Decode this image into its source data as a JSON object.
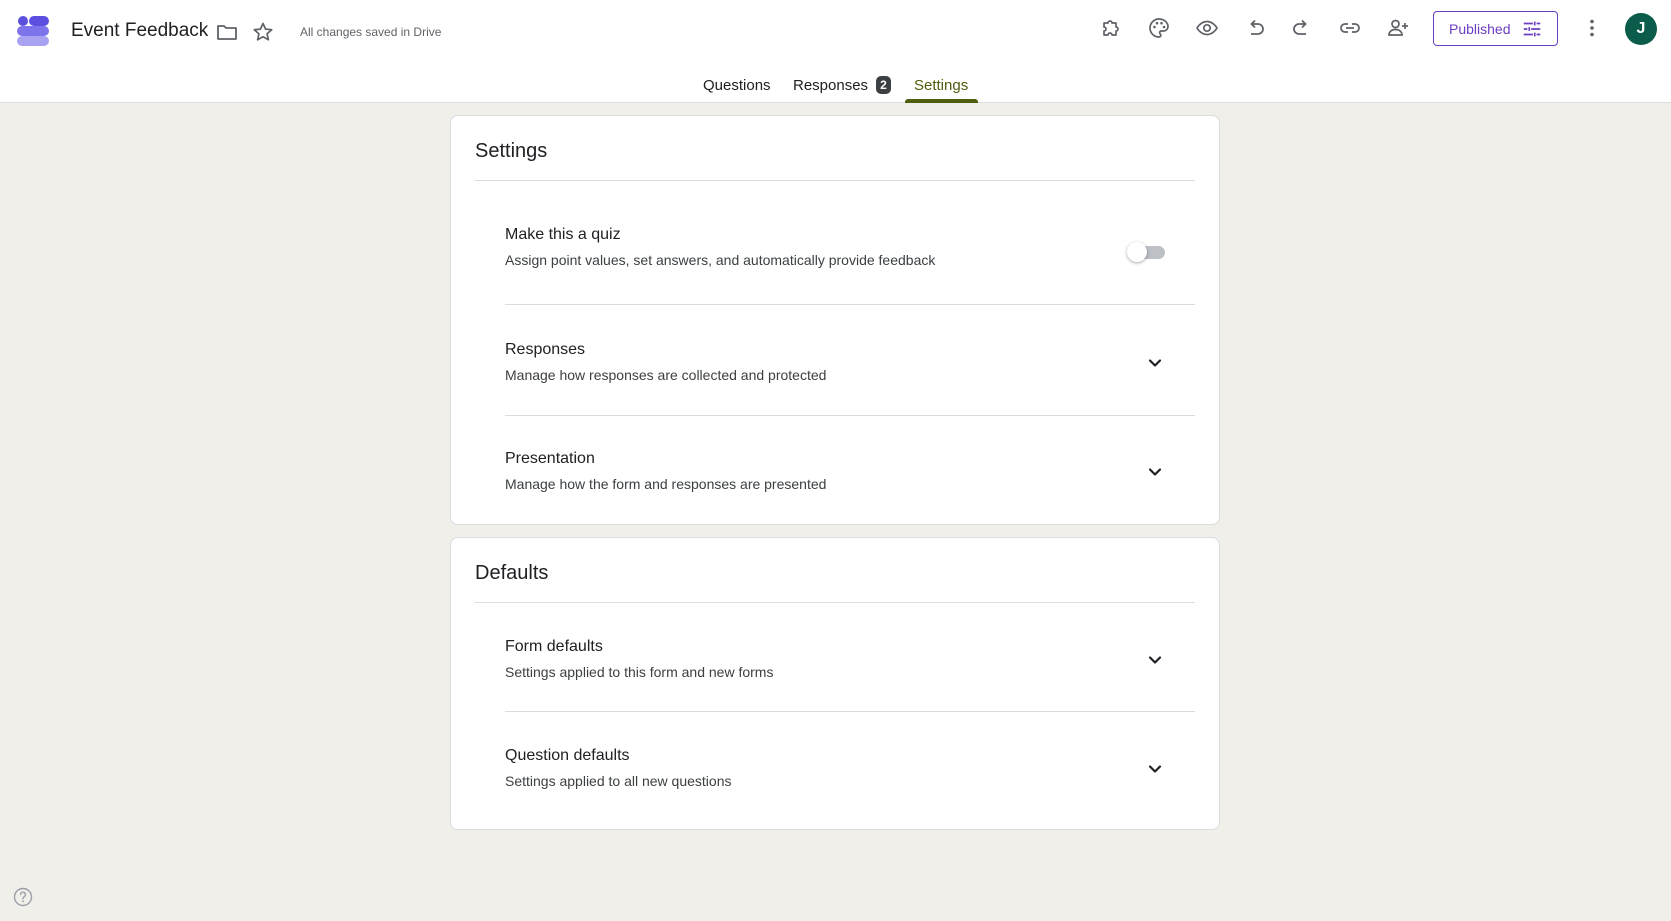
{
  "header": {
    "doc_title": "Event Feedback",
    "save_status": "All changes saved in Drive",
    "publish_label": "Published",
    "avatar_letter": "J"
  },
  "tabs": [
    {
      "label": "Questions"
    },
    {
      "label": "Responses",
      "badge": "2"
    },
    {
      "label": "Settings",
      "active": true
    }
  ],
  "settings_card": {
    "title": "Settings",
    "rows": [
      {
        "title": "Make this a quiz",
        "desc": "Assign point values, set answers, and automatically provide feedback",
        "control": "toggle",
        "on": false
      },
      {
        "title": "Responses",
        "desc": "Manage how responses are collected and protected",
        "control": "expand"
      },
      {
        "title": "Presentation",
        "desc": "Manage how the form and responses are presented",
        "control": "expand"
      }
    ]
  },
  "defaults_card": {
    "title": "Defaults",
    "rows": [
      {
        "title": "Form defaults",
        "desc": "Settings applied to this form and new forms",
        "control": "expand"
      },
      {
        "title": "Question defaults",
        "desc": "Settings applied to all new questions",
        "control": "expand"
      }
    ]
  },
  "icons": {
    "logo": "forms-logo-icon",
    "folder": "folder-icon",
    "star": "star-icon",
    "addons": "puzzle-icon",
    "theme": "palette-icon",
    "preview": "eye-icon",
    "undo": "undo-icon",
    "redo": "redo-icon",
    "link": "link-icon",
    "collaborators": "person-add-icon",
    "publish_options": "tune-icon",
    "more": "more-vert-icon",
    "help": "help-icon"
  },
  "colors": {
    "accent": "#4d5e0e",
    "publish": "#6b3fc2",
    "avatar_bg": "#0b5c4a",
    "page_bg": "#f0efea"
  }
}
